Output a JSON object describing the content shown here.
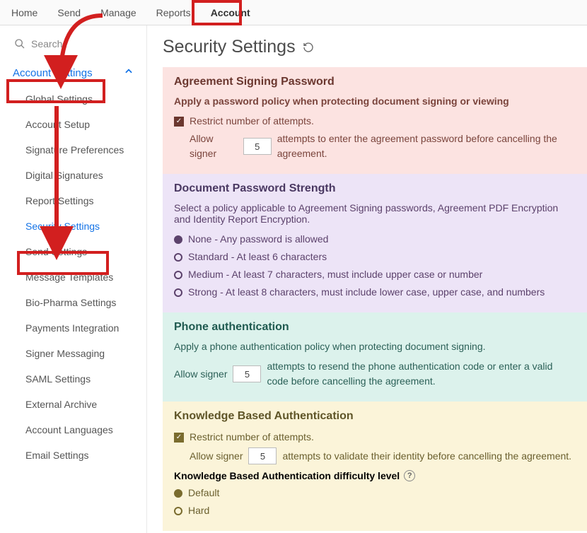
{
  "topnav": {
    "tabs": [
      "Home",
      "Send",
      "Manage",
      "Reports",
      "Account"
    ],
    "active": 4
  },
  "search": {
    "placeholder": "Search"
  },
  "sidebar": {
    "section": "Account Settings",
    "items": [
      "Global Settings",
      "Account Setup",
      "Signature Preferences",
      "Digital Signatures",
      "Report Settings",
      "Security Settings",
      "Send Settings",
      "Message Templates",
      "Bio-Pharma Settings",
      "Payments Integration",
      "Signer Messaging",
      "SAML Settings",
      "External Archive",
      "Account Languages",
      "Email Settings"
    ],
    "selected": 5
  },
  "page": {
    "title": "Security Settings"
  },
  "agreement": {
    "heading": "Agreement Signing Password",
    "desc": "Apply a password policy when protecting document signing or viewing",
    "restrict": "Restrict number of attempts.",
    "allow_pre": "Allow signer",
    "attempts": "5",
    "allow_post": "attempts to enter the agreement password before cancelling the agreement."
  },
  "strength": {
    "heading": "Document Password Strength",
    "desc": "Select a policy applicable to Agreement Signing passwords, Agreement PDF Encryption and Identity Report Encryption.",
    "opts": [
      "None - Any password is allowed",
      "Standard - At least 6 characters",
      "Medium - At least 7 characters, must include upper case or number",
      "Strong - At least 8 characters, must include lower case, upper case, and numbers"
    ],
    "selected": 0
  },
  "phone": {
    "heading": "Phone authentication",
    "desc": "Apply a phone authentication policy when protecting document signing.",
    "allow_pre": "Allow signer",
    "attempts": "5",
    "allow_post": "attempts to resend the phone authentication code or enter a valid code before cancelling the agreement."
  },
  "kba": {
    "heading": "Knowledge Based Authentication",
    "restrict": "Restrict number of attempts.",
    "allow_pre": "Allow signer",
    "attempts": "5",
    "allow_post": "attempts to validate their identity before cancelling the agreement.",
    "diff_label": "Knowledge Based Authentication difficulty level",
    "opts": [
      "Default",
      "Hard"
    ],
    "selected": 0
  }
}
